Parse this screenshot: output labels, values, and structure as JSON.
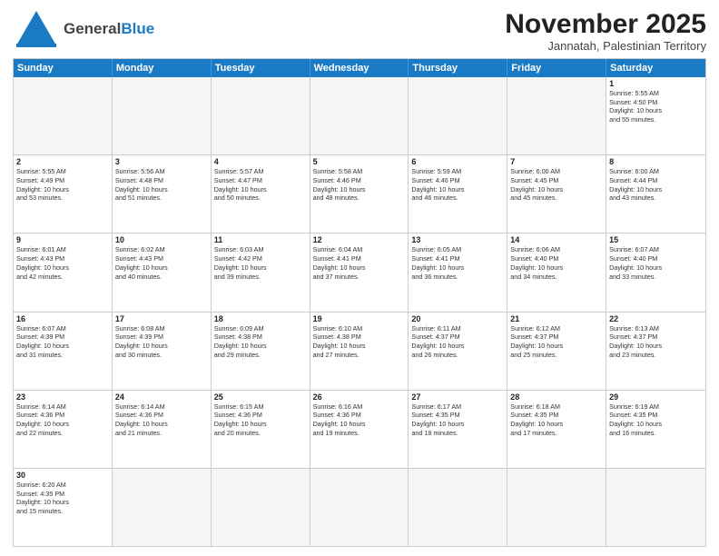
{
  "header": {
    "logo_general": "General",
    "logo_blue": "Blue",
    "month_year": "November 2025",
    "location": "Jannatah, Palestinian Territory"
  },
  "days_of_week": [
    "Sunday",
    "Monday",
    "Tuesday",
    "Wednesday",
    "Thursday",
    "Friday",
    "Saturday"
  ],
  "weeks": [
    [
      {
        "day": "",
        "info": ""
      },
      {
        "day": "",
        "info": ""
      },
      {
        "day": "",
        "info": ""
      },
      {
        "day": "",
        "info": ""
      },
      {
        "day": "",
        "info": ""
      },
      {
        "day": "",
        "info": ""
      },
      {
        "day": "1",
        "info": "Sunrise: 5:55 AM\nSunset: 4:50 PM\nDaylight: 10 hours\nand 55 minutes."
      }
    ],
    [
      {
        "day": "2",
        "info": "Sunrise: 5:55 AM\nSunset: 4:49 PM\nDaylight: 10 hours\nand 53 minutes."
      },
      {
        "day": "3",
        "info": "Sunrise: 5:56 AM\nSunset: 4:48 PM\nDaylight: 10 hours\nand 51 minutes."
      },
      {
        "day": "4",
        "info": "Sunrise: 5:57 AM\nSunset: 4:47 PM\nDaylight: 10 hours\nand 50 minutes."
      },
      {
        "day": "5",
        "info": "Sunrise: 5:58 AM\nSunset: 4:46 PM\nDaylight: 10 hours\nand 48 minutes."
      },
      {
        "day": "6",
        "info": "Sunrise: 5:59 AM\nSunset: 4:46 PM\nDaylight: 10 hours\nand 46 minutes."
      },
      {
        "day": "7",
        "info": "Sunrise: 6:00 AM\nSunset: 4:45 PM\nDaylight: 10 hours\nand 45 minutes."
      },
      {
        "day": "8",
        "info": "Sunrise: 6:00 AM\nSunset: 4:44 PM\nDaylight: 10 hours\nand 43 minutes."
      }
    ],
    [
      {
        "day": "9",
        "info": "Sunrise: 6:01 AM\nSunset: 4:43 PM\nDaylight: 10 hours\nand 42 minutes."
      },
      {
        "day": "10",
        "info": "Sunrise: 6:02 AM\nSunset: 4:43 PM\nDaylight: 10 hours\nand 40 minutes."
      },
      {
        "day": "11",
        "info": "Sunrise: 6:03 AM\nSunset: 4:42 PM\nDaylight: 10 hours\nand 39 minutes."
      },
      {
        "day": "12",
        "info": "Sunrise: 6:04 AM\nSunset: 4:41 PM\nDaylight: 10 hours\nand 37 minutes."
      },
      {
        "day": "13",
        "info": "Sunrise: 6:05 AM\nSunset: 4:41 PM\nDaylight: 10 hours\nand 36 minutes."
      },
      {
        "day": "14",
        "info": "Sunrise: 6:06 AM\nSunset: 4:40 PM\nDaylight: 10 hours\nand 34 minutes."
      },
      {
        "day": "15",
        "info": "Sunrise: 6:07 AM\nSunset: 4:40 PM\nDaylight: 10 hours\nand 33 minutes."
      }
    ],
    [
      {
        "day": "16",
        "info": "Sunrise: 6:07 AM\nSunset: 4:39 PM\nDaylight: 10 hours\nand 31 minutes."
      },
      {
        "day": "17",
        "info": "Sunrise: 6:08 AM\nSunset: 4:39 PM\nDaylight: 10 hours\nand 30 minutes."
      },
      {
        "day": "18",
        "info": "Sunrise: 6:09 AM\nSunset: 4:38 PM\nDaylight: 10 hours\nand 29 minutes."
      },
      {
        "day": "19",
        "info": "Sunrise: 6:10 AM\nSunset: 4:38 PM\nDaylight: 10 hours\nand 27 minutes."
      },
      {
        "day": "20",
        "info": "Sunrise: 6:11 AM\nSunset: 4:37 PM\nDaylight: 10 hours\nand 26 minutes."
      },
      {
        "day": "21",
        "info": "Sunrise: 6:12 AM\nSunset: 4:37 PM\nDaylight: 10 hours\nand 25 minutes."
      },
      {
        "day": "22",
        "info": "Sunrise: 6:13 AM\nSunset: 4:37 PM\nDaylight: 10 hours\nand 23 minutes."
      }
    ],
    [
      {
        "day": "23",
        "info": "Sunrise: 6:14 AM\nSunset: 4:36 PM\nDaylight: 10 hours\nand 22 minutes."
      },
      {
        "day": "24",
        "info": "Sunrise: 6:14 AM\nSunset: 4:36 PM\nDaylight: 10 hours\nand 21 minutes."
      },
      {
        "day": "25",
        "info": "Sunrise: 6:15 AM\nSunset: 4:36 PM\nDaylight: 10 hours\nand 20 minutes."
      },
      {
        "day": "26",
        "info": "Sunrise: 6:16 AM\nSunset: 4:36 PM\nDaylight: 10 hours\nand 19 minutes."
      },
      {
        "day": "27",
        "info": "Sunrise: 6:17 AM\nSunset: 4:35 PM\nDaylight: 10 hours\nand 18 minutes."
      },
      {
        "day": "28",
        "info": "Sunrise: 6:18 AM\nSunset: 4:35 PM\nDaylight: 10 hours\nand 17 minutes."
      },
      {
        "day": "29",
        "info": "Sunrise: 6:19 AM\nSunset: 4:35 PM\nDaylight: 10 hours\nand 16 minutes."
      }
    ],
    [
      {
        "day": "30",
        "info": "Sunrise: 6:20 AM\nSunset: 4:35 PM\nDaylight: 10 hours\nand 15 minutes."
      },
      {
        "day": "",
        "info": ""
      },
      {
        "day": "",
        "info": ""
      },
      {
        "day": "",
        "info": ""
      },
      {
        "day": "",
        "info": ""
      },
      {
        "day": "",
        "info": ""
      },
      {
        "day": "",
        "info": ""
      }
    ]
  ]
}
